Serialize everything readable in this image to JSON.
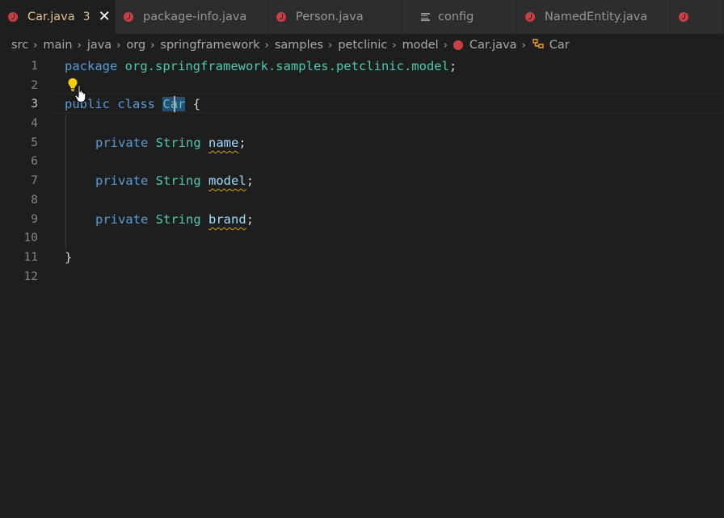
{
  "tabs": [
    {
      "label": "Car.java",
      "badge": "3",
      "close": "✕",
      "active": true,
      "icon": "java-file-icon"
    },
    {
      "label": "package-info.java",
      "icon": "java-file-icon"
    },
    {
      "label": "Person.java",
      "icon": "java-file-icon"
    },
    {
      "label": "config",
      "icon": "config-file-icon"
    },
    {
      "label": "NamedEntity.java",
      "icon": "java-file-icon"
    },
    {
      "label": "",
      "icon": "java-file-icon"
    }
  ],
  "breadcrumb": {
    "items": [
      "src",
      "main",
      "java",
      "org",
      "springframework",
      "samples",
      "petclinic",
      "model",
      "Car.java",
      "Car"
    ],
    "separator": "›"
  },
  "editor": {
    "line_numbers": [
      "1",
      "2",
      "3",
      "4",
      "5",
      "6",
      "7",
      "8",
      "9",
      "10",
      "11",
      "12"
    ],
    "current_line": "3",
    "tokens": {
      "package_kw": "package",
      "package_name": "org.springframework.samples.petclinic.model",
      "semicolon": ";",
      "public_kw": "public",
      "class_kw": "class",
      "class_name": "Car",
      "open_brace": "{",
      "close_brace": "}",
      "private_kw": "private",
      "string_type": "String",
      "field_name": "name",
      "field_model": "model",
      "field_brand": "brand"
    }
  },
  "colors": {
    "keyword": "#569cd6",
    "type": "#4ec9b0",
    "variable": "#9cdcfe",
    "warning": "#cca700",
    "tab_modified": "#e2c08d",
    "java_icon": "#cc3e44"
  },
  "icons": [
    "lightbulb-icon",
    "hand-pointer-cursor",
    "symbol-class-icon"
  ]
}
